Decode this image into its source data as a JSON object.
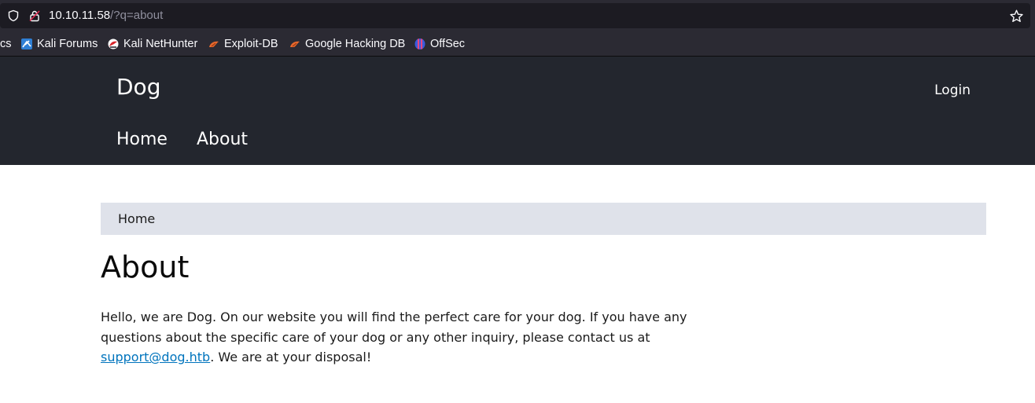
{
  "browser": {
    "url_host": "10.10.11.58",
    "url_path": "/?q=about",
    "bookmarks": [
      {
        "label": "cs",
        "icon": "cut-off-bookmark"
      },
      {
        "label": "Kali Forums",
        "icon": "kali-dragon-icon"
      },
      {
        "label": "Kali NetHunter",
        "icon": "nethunter-icon"
      },
      {
        "label": "Exploit-DB",
        "icon": "exploitdb-icon"
      },
      {
        "label": "Google Hacking DB",
        "icon": "ghdb-icon"
      },
      {
        "label": "OffSec",
        "icon": "offsec-icon"
      }
    ]
  },
  "header": {
    "site_name": "Dog",
    "login_label": "Login",
    "nav": [
      {
        "label": "Home"
      },
      {
        "label": "About"
      }
    ]
  },
  "main": {
    "breadcrumb": "Home",
    "title": "About",
    "paragraph_before": "Hello, we are Dog. On our website you will find the perfect care for your dog. If you have any questions about the specific care of your dog or any other inquiry, please contact us at ",
    "email_link": "support@dog.htb",
    "paragraph_after": ". We are at your disposal!"
  },
  "colors": {
    "header_bg": "#23262e",
    "breadcrumb_bg": "#dfe2ea",
    "link": "#0074bd"
  }
}
